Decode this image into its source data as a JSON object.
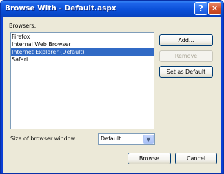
{
  "window": {
    "title": "Browse With - Default.aspx",
    "help_glyph": "?",
    "close_glyph": "✕"
  },
  "browsers": {
    "label": "Browsers:",
    "items": [
      {
        "label": "Firefox",
        "selected": false
      },
      {
        "label": "Internal Web Browser",
        "selected": false
      },
      {
        "label": "Internet Explorer (Default)",
        "selected": true
      },
      {
        "label": "Safari",
        "selected": false
      }
    ]
  },
  "side_buttons": {
    "add": "Add...",
    "remove": "Remove",
    "set_default": "Set as Default"
  },
  "window_size": {
    "label": "Size of browser window:",
    "value": "Default",
    "arrow_glyph": "▼"
  },
  "footer": {
    "browse": "Browse",
    "cancel": "Cancel"
  }
}
